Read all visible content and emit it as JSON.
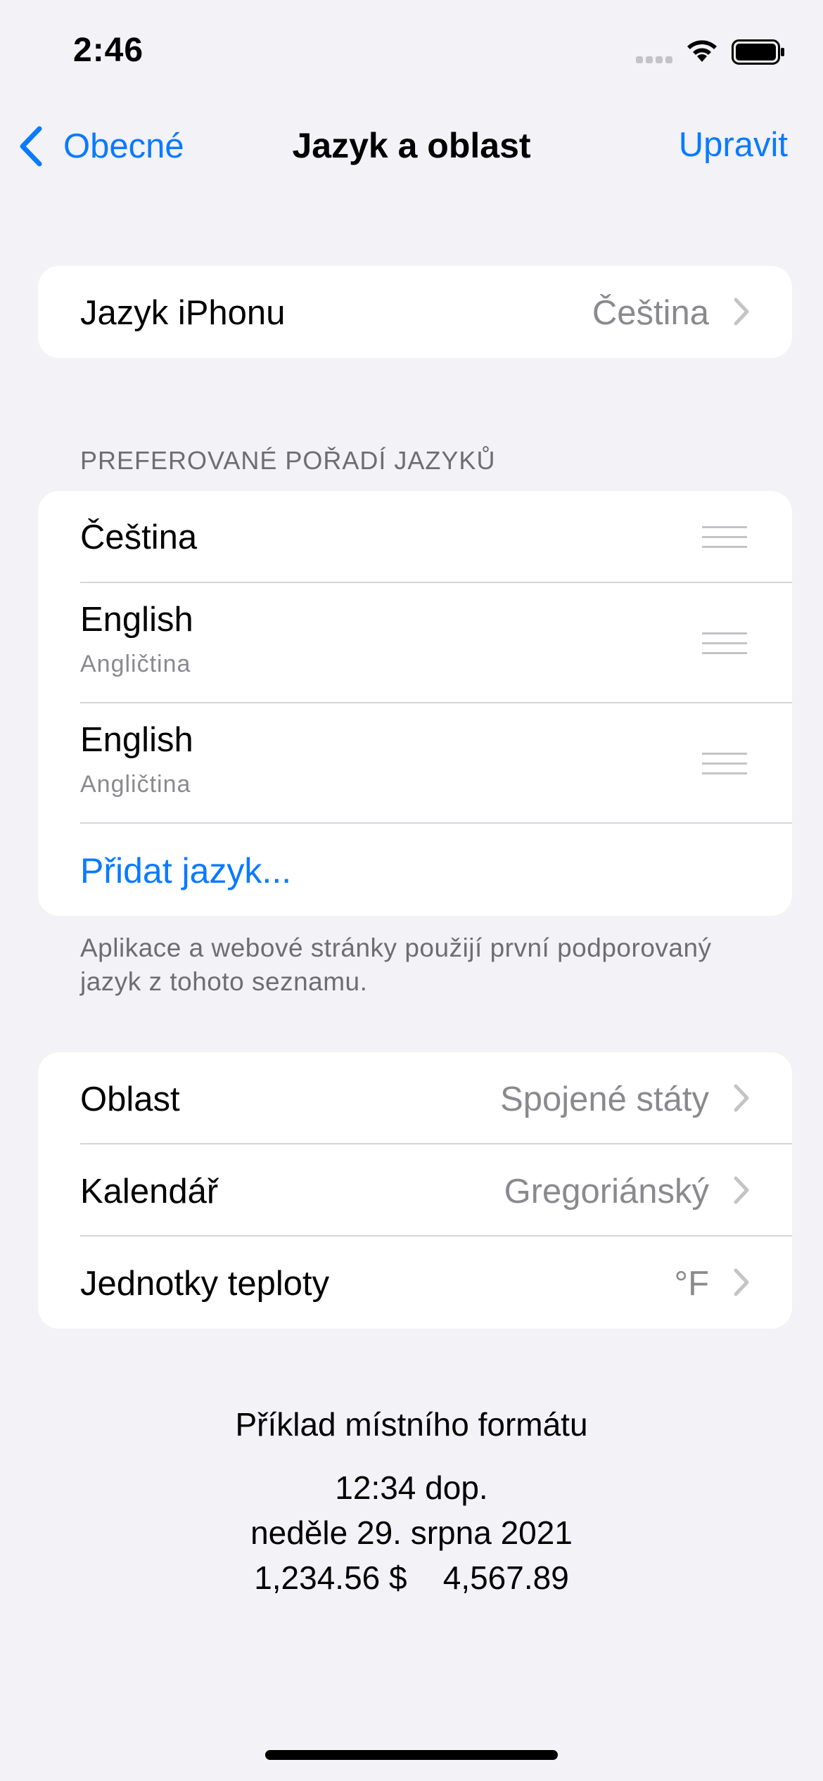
{
  "status_bar": {
    "time": "2:46"
  },
  "nav": {
    "back_label": "Obecné",
    "title": "Jazyk a oblast",
    "edit_label": "Upravit"
  },
  "iphone_language": {
    "label": "Jazyk iPhonu",
    "value": "Čeština"
  },
  "preferred": {
    "header": "PREFEROVANÉ POŘADÍ JAZYKŮ",
    "languages": [
      {
        "name": "Čeština",
        "subtitle": ""
      },
      {
        "name": "English",
        "subtitle": "Angličtina"
      },
      {
        "name": "English",
        "subtitle": "Angličtina"
      }
    ],
    "add_label": "Přidat jazyk...",
    "footer": "Aplikace a webové stránky použijí první podporovaný jazyk z tohoto seznamu."
  },
  "region_settings": [
    {
      "label": "Oblast",
      "value": "Spojené státy"
    },
    {
      "label": "Kalendář",
      "value": "Gregoriánský"
    },
    {
      "label": "Jednotky teploty",
      "value": "°F"
    }
  ],
  "format_example": {
    "title": "Příklad místního formátu",
    "time": "12:34 dop.",
    "date": "neděle 29. srpna 2021",
    "numbers": "1,234.56 $    4,567.89"
  },
  "colors": {
    "accent": "#0a7aff",
    "background": "#f2f2f7",
    "secondary": "#8a8a8e"
  }
}
